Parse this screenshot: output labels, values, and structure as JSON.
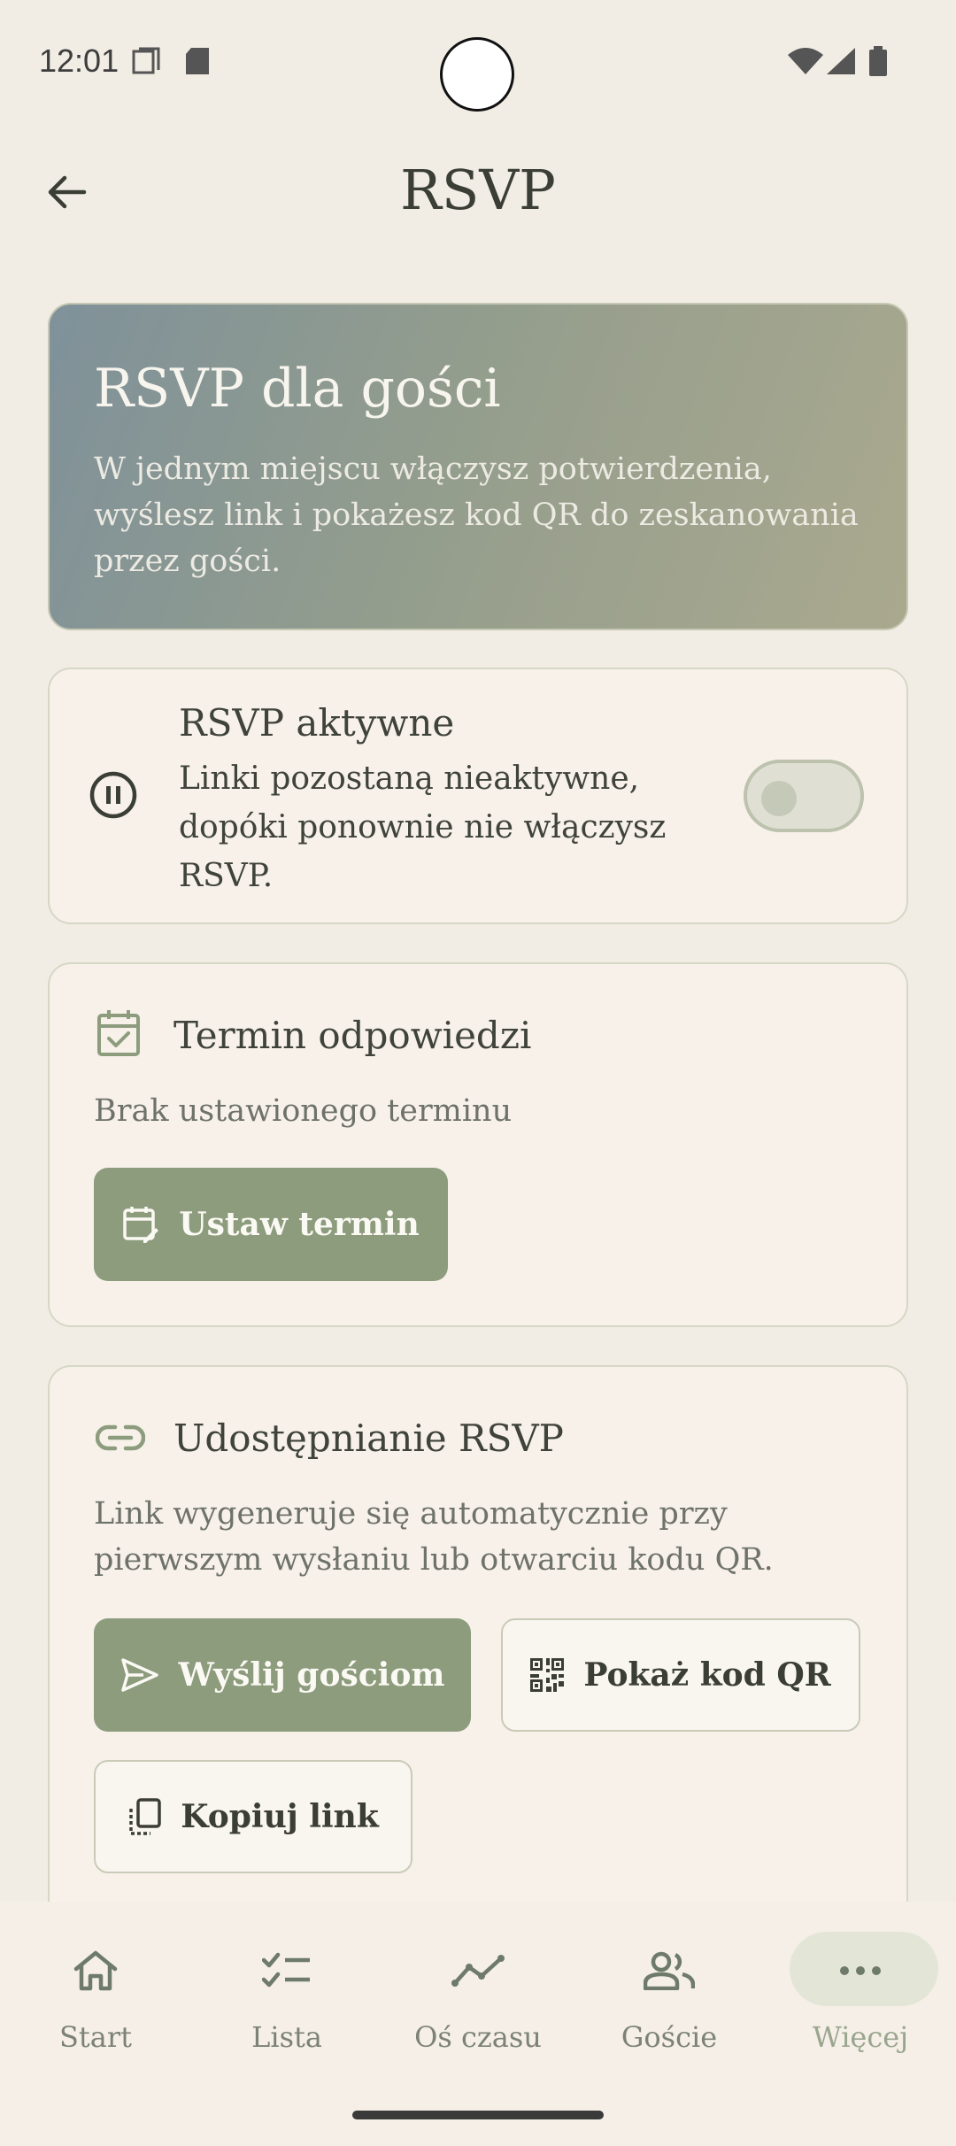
{
  "status": {
    "time": "12:01"
  },
  "header": {
    "title": "RSVP"
  },
  "hero": {
    "title": "RSVP dla gości",
    "description": "W jednym miejscu włączysz potwierdzenia, wyślesz link i pokażesz kod QR do zeskanowania przez gości."
  },
  "rsvp_toggle": {
    "title": "RSVP aktywne",
    "description": "Linki pozostaną nieaktywne, dopóki ponownie nie włączysz RSVP.",
    "enabled": false
  },
  "deadline": {
    "title": "Termin odpowiedzi",
    "status": "Brak ustawionego terminu",
    "set_button": "Ustaw termin"
  },
  "sharing": {
    "title": "Udostępnianie RSVP",
    "description": "Link wygeneruje się automatycznie przy pierwszym wysłaniu lub otwarciu kodu QR.",
    "send_button": "Wyślij gościom",
    "qr_button": "Pokaż kod QR",
    "copy_button": "Kopiuj link"
  },
  "nav": {
    "items": [
      {
        "label": "Start",
        "icon": "home-icon"
      },
      {
        "label": "Lista",
        "icon": "checklist-icon"
      },
      {
        "label": "Oś czasu",
        "icon": "timeline-icon"
      },
      {
        "label": "Goście",
        "icon": "people-icon"
      },
      {
        "label": "Więcej",
        "icon": "more-icon",
        "active": true
      }
    ]
  },
  "colors": {
    "background": "#f1ede4",
    "accent": "#8c9c7d",
    "card": "#f7f1ea",
    "text": "#3f4339"
  }
}
